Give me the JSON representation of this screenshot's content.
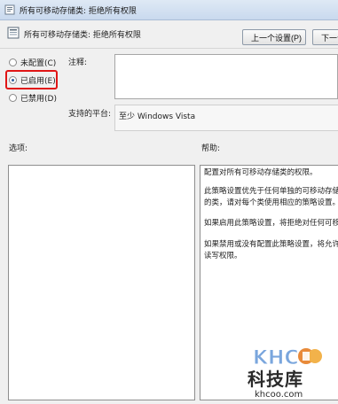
{
  "window": {
    "title": "所有可移动存储类: 拒绝所有权限"
  },
  "header": {
    "title": "所有可移动存储类: 拒绝所有权限"
  },
  "toolbar": {
    "prev_label": "上一个设置(P)",
    "next_label": "下一个"
  },
  "state_options": [
    {
      "label": "未配置(C)",
      "checked": false
    },
    {
      "label": "已启用(E)",
      "checked": true
    },
    {
      "label": "已禁用(D)",
      "checked": false
    }
  ],
  "comment": {
    "label": "注释:",
    "value": ""
  },
  "platform": {
    "label": "支持的平台:",
    "value": "至少 Windows Vista"
  },
  "options": {
    "label": "选项:"
  },
  "help": {
    "label": "帮助:",
    "paragraphs": [
      "配置对所有可移动存储类的权限。",
      "此策略设置优先于任何单独的可移动存储\n的类，请对每个类使用相应的策略设置。",
      "如果启用此策略设置，将拒绝对任何可移",
      "如果禁用或没有配置此策略设置，将允许\n读写权限。"
    ]
  },
  "watermark": {
    "brand": "KHCOO",
    "text": "科技库",
    "url": "khcoo.com"
  }
}
